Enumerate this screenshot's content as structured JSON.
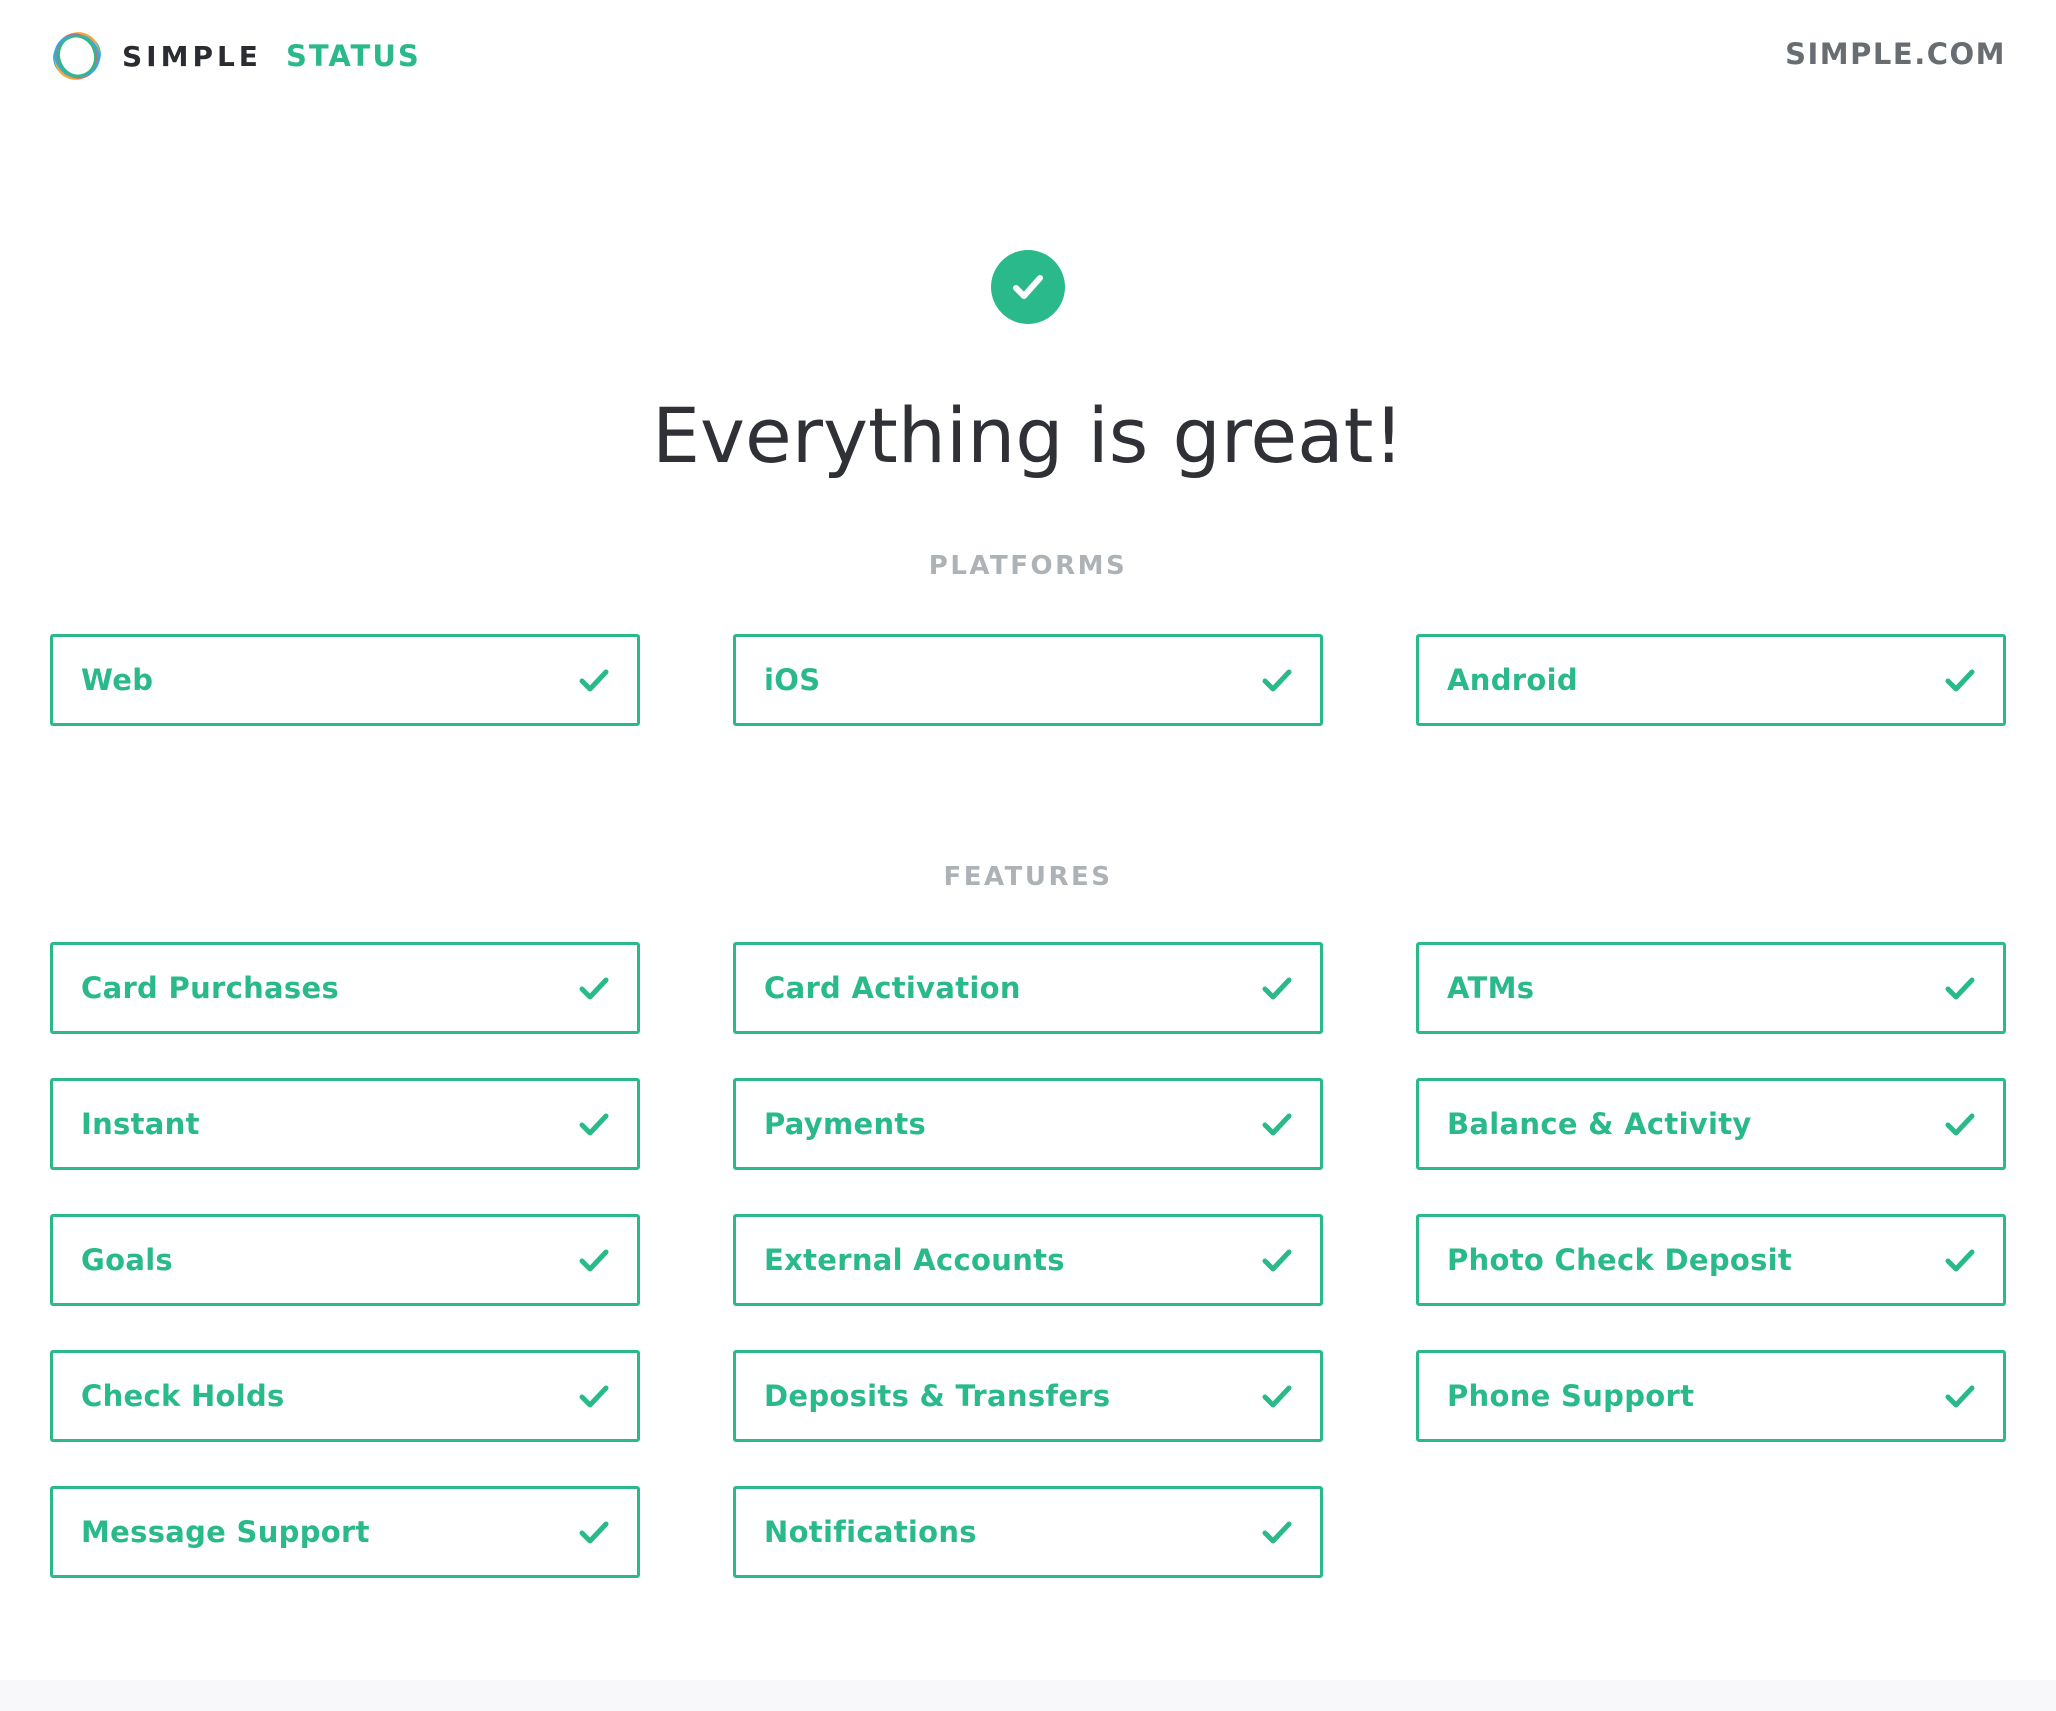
{
  "header": {
    "brand_name": "SIMPLE",
    "brand_product": "STATUS",
    "site_link": "SIMPLE.COM",
    "logo_icon": "simple-logo-icon"
  },
  "hero": {
    "status_icon": "check-circle-icon",
    "title": "Everything is great!"
  },
  "platforms": {
    "heading": "PLATFORMS",
    "items": [
      {
        "label": "Web",
        "status_icon": "check-icon"
      },
      {
        "label": "iOS",
        "status_icon": "check-icon"
      },
      {
        "label": "Android",
        "status_icon": "check-icon"
      }
    ]
  },
  "features": {
    "heading": "FEATURES",
    "items": [
      {
        "label": "Card Purchases",
        "status_icon": "check-icon"
      },
      {
        "label": "Card Activation",
        "status_icon": "check-icon"
      },
      {
        "label": "ATMs",
        "status_icon": "check-icon"
      },
      {
        "label": "Instant",
        "status_icon": "check-icon"
      },
      {
        "label": "Payments",
        "status_icon": "check-icon"
      },
      {
        "label": "Balance & Activity",
        "status_icon": "check-icon"
      },
      {
        "label": "Goals",
        "status_icon": "check-icon"
      },
      {
        "label": "External Accounts",
        "status_icon": "check-icon"
      },
      {
        "label": "Photo Check Deposit",
        "status_icon": "check-icon"
      },
      {
        "label": "Check Holds",
        "status_icon": "check-icon"
      },
      {
        "label": "Deposits & Transfers",
        "status_icon": "check-icon"
      },
      {
        "label": "Phone Support",
        "status_icon": "check-icon"
      },
      {
        "label": "Message Support",
        "status_icon": "check-icon"
      },
      {
        "label": "Notifications",
        "status_icon": "check-icon"
      }
    ]
  },
  "colors": {
    "accent": "#29b98a",
    "text_dark": "#2f3137",
    "text_muted": "#adb2b7",
    "link_gray": "#686d72"
  }
}
